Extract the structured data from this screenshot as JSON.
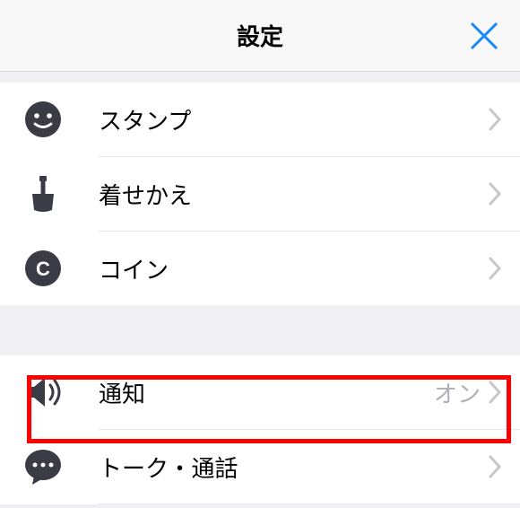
{
  "header": {
    "title": "設定"
  },
  "section1": {
    "items": [
      {
        "icon": "smiley",
        "label": "スタンプ"
      },
      {
        "icon": "brush",
        "label": "着せかえ"
      },
      {
        "icon": "coin",
        "label": "コイン"
      }
    ]
  },
  "section2": {
    "items": [
      {
        "icon": "speaker",
        "label": "通知",
        "value": "オン"
      },
      {
        "icon": "chat",
        "label": "トーク・通話"
      }
    ]
  }
}
